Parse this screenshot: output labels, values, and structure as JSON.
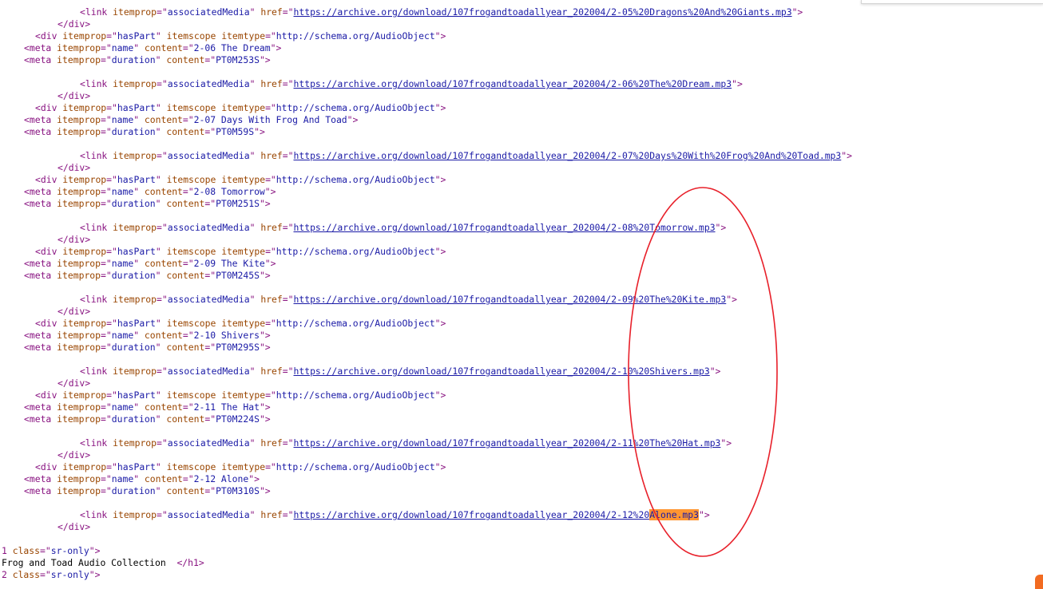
{
  "lines": [
    {
      "indent": 14,
      "segments": [
        [
          "tag",
          "<link "
        ],
        [
          "attr",
          "itemprop"
        ],
        [
          "tag",
          "=\""
        ],
        [
          "val",
          "associatedMedia"
        ],
        [
          "tag",
          "\" "
        ],
        [
          "attr",
          "href"
        ],
        [
          "tag",
          "=\""
        ],
        [
          "link",
          "https://archive.org/download/107frogandtoadallyear_202004/2-05%20Dragons%20And%20Giants.mp3"
        ],
        [
          "tag",
          "\">"
        ]
      ]
    },
    {
      "indent": 10,
      "segments": [
        [
          "tag",
          "</div>"
        ]
      ]
    },
    {
      "indent": 6,
      "segments": [
        [
          "tag",
          "<div "
        ],
        [
          "attr",
          "itemprop"
        ],
        [
          "tag",
          "=\""
        ],
        [
          "val",
          "hasPart"
        ],
        [
          "tag",
          "\" "
        ],
        [
          "attr",
          "itemscope itemtype"
        ],
        [
          "tag",
          "=\""
        ],
        [
          "val",
          "http://schema.org/AudioObject"
        ],
        [
          "tag",
          "\">"
        ]
      ]
    },
    {
      "indent": 4,
      "segments": [
        [
          "tag",
          "<meta "
        ],
        [
          "attr",
          "itemprop"
        ],
        [
          "tag",
          "=\""
        ],
        [
          "val",
          "name"
        ],
        [
          "tag",
          "\" "
        ],
        [
          "attr",
          "content"
        ],
        [
          "tag",
          "=\""
        ],
        [
          "val",
          "2-06 The Dream"
        ],
        [
          "tag",
          "\">"
        ]
      ]
    },
    {
      "indent": 4,
      "segments": [
        [
          "tag",
          "<meta "
        ],
        [
          "attr",
          "itemprop"
        ],
        [
          "tag",
          "=\""
        ],
        [
          "val",
          "duration"
        ],
        [
          "tag",
          "\" "
        ],
        [
          "attr",
          "content"
        ],
        [
          "tag",
          "=\""
        ],
        [
          "val",
          "PT0M253S"
        ],
        [
          "tag",
          "\">"
        ]
      ]
    },
    {
      "indent": 0,
      "segments": []
    },
    {
      "indent": 14,
      "segments": [
        [
          "tag",
          "<link "
        ],
        [
          "attr",
          "itemprop"
        ],
        [
          "tag",
          "=\""
        ],
        [
          "val",
          "associatedMedia"
        ],
        [
          "tag",
          "\" "
        ],
        [
          "attr",
          "href"
        ],
        [
          "tag",
          "=\""
        ],
        [
          "link",
          "https://archive.org/download/107frogandtoadallyear_202004/2-06%20The%20Dream.mp3"
        ],
        [
          "tag",
          "\">"
        ]
      ]
    },
    {
      "indent": 10,
      "segments": [
        [
          "tag",
          "</div>"
        ]
      ]
    },
    {
      "indent": 6,
      "segments": [
        [
          "tag",
          "<div "
        ],
        [
          "attr",
          "itemprop"
        ],
        [
          "tag",
          "=\""
        ],
        [
          "val",
          "hasPart"
        ],
        [
          "tag",
          "\" "
        ],
        [
          "attr",
          "itemscope itemtype"
        ],
        [
          "tag",
          "=\""
        ],
        [
          "val",
          "http://schema.org/AudioObject"
        ],
        [
          "tag",
          "\">"
        ]
      ]
    },
    {
      "indent": 4,
      "segments": [
        [
          "tag",
          "<meta "
        ],
        [
          "attr",
          "itemprop"
        ],
        [
          "tag",
          "=\""
        ],
        [
          "val",
          "name"
        ],
        [
          "tag",
          "\" "
        ],
        [
          "attr",
          "content"
        ],
        [
          "tag",
          "=\""
        ],
        [
          "val",
          "2-07 Days With Frog And Toad"
        ],
        [
          "tag",
          "\">"
        ]
      ]
    },
    {
      "indent": 4,
      "segments": [
        [
          "tag",
          "<meta "
        ],
        [
          "attr",
          "itemprop"
        ],
        [
          "tag",
          "=\""
        ],
        [
          "val",
          "duration"
        ],
        [
          "tag",
          "\" "
        ],
        [
          "attr",
          "content"
        ],
        [
          "tag",
          "=\""
        ],
        [
          "val",
          "PT0M59S"
        ],
        [
          "tag",
          "\">"
        ]
      ]
    },
    {
      "indent": 0,
      "segments": []
    },
    {
      "indent": 14,
      "segments": [
        [
          "tag",
          "<link "
        ],
        [
          "attr",
          "itemprop"
        ],
        [
          "tag",
          "=\""
        ],
        [
          "val",
          "associatedMedia"
        ],
        [
          "tag",
          "\" "
        ],
        [
          "attr",
          "href"
        ],
        [
          "tag",
          "=\""
        ],
        [
          "link",
          "https://archive.org/download/107frogandtoadallyear_202004/2-07%20Days%20With%20Frog%20And%20Toad.mp3"
        ],
        [
          "tag",
          "\">"
        ]
      ]
    },
    {
      "indent": 10,
      "segments": [
        [
          "tag",
          "</div>"
        ]
      ]
    },
    {
      "indent": 6,
      "segments": [
        [
          "tag",
          "<div "
        ],
        [
          "attr",
          "itemprop"
        ],
        [
          "tag",
          "=\""
        ],
        [
          "val",
          "hasPart"
        ],
        [
          "tag",
          "\" "
        ],
        [
          "attr",
          "itemscope itemtype"
        ],
        [
          "tag",
          "=\""
        ],
        [
          "val",
          "http://schema.org/AudioObject"
        ],
        [
          "tag",
          "\">"
        ]
      ]
    },
    {
      "indent": 4,
      "segments": [
        [
          "tag",
          "<meta "
        ],
        [
          "attr",
          "itemprop"
        ],
        [
          "tag",
          "=\""
        ],
        [
          "val",
          "name"
        ],
        [
          "tag",
          "\" "
        ],
        [
          "attr",
          "content"
        ],
        [
          "tag",
          "=\""
        ],
        [
          "val",
          "2-08 Tomorrow"
        ],
        [
          "tag",
          "\">"
        ]
      ]
    },
    {
      "indent": 4,
      "segments": [
        [
          "tag",
          "<meta "
        ],
        [
          "attr",
          "itemprop"
        ],
        [
          "tag",
          "=\""
        ],
        [
          "val",
          "duration"
        ],
        [
          "tag",
          "\" "
        ],
        [
          "attr",
          "content"
        ],
        [
          "tag",
          "=\""
        ],
        [
          "val",
          "PT0M251S"
        ],
        [
          "tag",
          "\">"
        ]
      ]
    },
    {
      "indent": 0,
      "segments": []
    },
    {
      "indent": 14,
      "segments": [
        [
          "tag",
          "<link "
        ],
        [
          "attr",
          "itemprop"
        ],
        [
          "tag",
          "=\""
        ],
        [
          "val",
          "associatedMedia"
        ],
        [
          "tag",
          "\" "
        ],
        [
          "attr",
          "href"
        ],
        [
          "tag",
          "=\""
        ],
        [
          "link",
          "https://archive.org/download/107frogandtoadallyear_202004/2-08%20Tomorrow.mp3"
        ],
        [
          "tag",
          "\">"
        ]
      ]
    },
    {
      "indent": 10,
      "segments": [
        [
          "tag",
          "</div>"
        ]
      ]
    },
    {
      "indent": 6,
      "segments": [
        [
          "tag",
          "<div "
        ],
        [
          "attr",
          "itemprop"
        ],
        [
          "tag",
          "=\""
        ],
        [
          "val",
          "hasPart"
        ],
        [
          "tag",
          "\" "
        ],
        [
          "attr",
          "itemscope itemtype"
        ],
        [
          "tag",
          "=\""
        ],
        [
          "val",
          "http://schema.org/AudioObject"
        ],
        [
          "tag",
          "\">"
        ]
      ]
    },
    {
      "indent": 4,
      "segments": [
        [
          "tag",
          "<meta "
        ],
        [
          "attr",
          "itemprop"
        ],
        [
          "tag",
          "=\""
        ],
        [
          "val",
          "name"
        ],
        [
          "tag",
          "\" "
        ],
        [
          "attr",
          "content"
        ],
        [
          "tag",
          "=\""
        ],
        [
          "val",
          "2-09 The Kite"
        ],
        [
          "tag",
          "\">"
        ]
      ]
    },
    {
      "indent": 4,
      "segments": [
        [
          "tag",
          "<meta "
        ],
        [
          "attr",
          "itemprop"
        ],
        [
          "tag",
          "=\""
        ],
        [
          "val",
          "duration"
        ],
        [
          "tag",
          "\" "
        ],
        [
          "attr",
          "content"
        ],
        [
          "tag",
          "=\""
        ],
        [
          "val",
          "PT0M245S"
        ],
        [
          "tag",
          "\">"
        ]
      ]
    },
    {
      "indent": 0,
      "segments": []
    },
    {
      "indent": 14,
      "segments": [
        [
          "tag",
          "<link "
        ],
        [
          "attr",
          "itemprop"
        ],
        [
          "tag",
          "=\""
        ],
        [
          "val",
          "associatedMedia"
        ],
        [
          "tag",
          "\" "
        ],
        [
          "attr",
          "href"
        ],
        [
          "tag",
          "=\""
        ],
        [
          "link",
          "https://archive.org/download/107frogandtoadallyear_202004/2-09%20The%20Kite.mp3"
        ],
        [
          "tag",
          "\">"
        ]
      ]
    },
    {
      "indent": 10,
      "segments": [
        [
          "tag",
          "</div>"
        ]
      ]
    },
    {
      "indent": 6,
      "segments": [
        [
          "tag",
          "<div "
        ],
        [
          "attr",
          "itemprop"
        ],
        [
          "tag",
          "=\""
        ],
        [
          "val",
          "hasPart"
        ],
        [
          "tag",
          "\" "
        ],
        [
          "attr",
          "itemscope itemtype"
        ],
        [
          "tag",
          "=\""
        ],
        [
          "val",
          "http://schema.org/AudioObject"
        ],
        [
          "tag",
          "\">"
        ]
      ]
    },
    {
      "indent": 4,
      "segments": [
        [
          "tag",
          "<meta "
        ],
        [
          "attr",
          "itemprop"
        ],
        [
          "tag",
          "=\""
        ],
        [
          "val",
          "name"
        ],
        [
          "tag",
          "\" "
        ],
        [
          "attr",
          "content"
        ],
        [
          "tag",
          "=\""
        ],
        [
          "val",
          "2-10 Shivers"
        ],
        [
          "tag",
          "\">"
        ]
      ]
    },
    {
      "indent": 4,
      "segments": [
        [
          "tag",
          "<meta "
        ],
        [
          "attr",
          "itemprop"
        ],
        [
          "tag",
          "=\""
        ],
        [
          "val",
          "duration"
        ],
        [
          "tag",
          "\" "
        ],
        [
          "attr",
          "content"
        ],
        [
          "tag",
          "=\""
        ],
        [
          "val",
          "PT0M295S"
        ],
        [
          "tag",
          "\">"
        ]
      ]
    },
    {
      "indent": 0,
      "segments": []
    },
    {
      "indent": 14,
      "segments": [
        [
          "tag",
          "<link "
        ],
        [
          "attr",
          "itemprop"
        ],
        [
          "tag",
          "=\""
        ],
        [
          "val",
          "associatedMedia"
        ],
        [
          "tag",
          "\" "
        ],
        [
          "attr",
          "href"
        ],
        [
          "tag",
          "=\""
        ],
        [
          "link",
          "https://archive.org/download/107frogandtoadallyear_202004/2-10%20Shivers.mp3"
        ],
        [
          "tag",
          "\">"
        ]
      ]
    },
    {
      "indent": 10,
      "segments": [
        [
          "tag",
          "</div>"
        ]
      ]
    },
    {
      "indent": 6,
      "segments": [
        [
          "tag",
          "<div "
        ],
        [
          "attr",
          "itemprop"
        ],
        [
          "tag",
          "=\""
        ],
        [
          "val",
          "hasPart"
        ],
        [
          "tag",
          "\" "
        ],
        [
          "attr",
          "itemscope itemtype"
        ],
        [
          "tag",
          "=\""
        ],
        [
          "val",
          "http://schema.org/AudioObject"
        ],
        [
          "tag",
          "\">"
        ]
      ]
    },
    {
      "indent": 4,
      "segments": [
        [
          "tag",
          "<meta "
        ],
        [
          "attr",
          "itemprop"
        ],
        [
          "tag",
          "=\""
        ],
        [
          "val",
          "name"
        ],
        [
          "tag",
          "\" "
        ],
        [
          "attr",
          "content"
        ],
        [
          "tag",
          "=\""
        ],
        [
          "val",
          "2-11 The Hat"
        ],
        [
          "tag",
          "\">"
        ]
      ]
    },
    {
      "indent": 4,
      "segments": [
        [
          "tag",
          "<meta "
        ],
        [
          "attr",
          "itemprop"
        ],
        [
          "tag",
          "=\""
        ],
        [
          "val",
          "duration"
        ],
        [
          "tag",
          "\" "
        ],
        [
          "attr",
          "content"
        ],
        [
          "tag",
          "=\""
        ],
        [
          "val",
          "PT0M224S"
        ],
        [
          "tag",
          "\">"
        ]
      ]
    },
    {
      "indent": 0,
      "segments": []
    },
    {
      "indent": 14,
      "segments": [
        [
          "tag",
          "<link "
        ],
        [
          "attr",
          "itemprop"
        ],
        [
          "tag",
          "=\""
        ],
        [
          "val",
          "associatedMedia"
        ],
        [
          "tag",
          "\" "
        ],
        [
          "attr",
          "href"
        ],
        [
          "tag",
          "=\""
        ],
        [
          "link",
          "https://archive.org/download/107frogandtoadallyear_202004/2-11%20The%20Hat.mp3"
        ],
        [
          "tag",
          "\">"
        ]
      ]
    },
    {
      "indent": 10,
      "segments": [
        [
          "tag",
          "</div>"
        ]
      ]
    },
    {
      "indent": 6,
      "segments": [
        [
          "tag",
          "<div "
        ],
        [
          "attr",
          "itemprop"
        ],
        [
          "tag",
          "=\""
        ],
        [
          "val",
          "hasPart"
        ],
        [
          "tag",
          "\" "
        ],
        [
          "attr",
          "itemscope itemtype"
        ],
        [
          "tag",
          "=\""
        ],
        [
          "val",
          "http://schema.org/AudioObject"
        ],
        [
          "tag",
          "\">"
        ]
      ]
    },
    {
      "indent": 4,
      "segments": [
        [
          "tag",
          "<meta "
        ],
        [
          "attr",
          "itemprop"
        ],
        [
          "tag",
          "=\""
        ],
        [
          "val",
          "name"
        ],
        [
          "tag",
          "\" "
        ],
        [
          "attr",
          "content"
        ],
        [
          "tag",
          "=\""
        ],
        [
          "val",
          "2-12 Alone"
        ],
        [
          "tag",
          "\">"
        ]
      ]
    },
    {
      "indent": 4,
      "segments": [
        [
          "tag",
          "<meta "
        ],
        [
          "attr",
          "itemprop"
        ],
        [
          "tag",
          "=\""
        ],
        [
          "val",
          "duration"
        ],
        [
          "tag",
          "\" "
        ],
        [
          "attr",
          "content"
        ],
        [
          "tag",
          "=\""
        ],
        [
          "val",
          "PT0M310S"
        ],
        [
          "tag",
          "\">"
        ]
      ]
    },
    {
      "indent": 0,
      "segments": []
    },
    {
      "indent": 14,
      "segments": [
        [
          "tag",
          "<link "
        ],
        [
          "attr",
          "itemprop"
        ],
        [
          "tag",
          "=\""
        ],
        [
          "val",
          "associatedMedia"
        ],
        [
          "tag",
          "\" "
        ],
        [
          "attr",
          "href"
        ],
        [
          "tag",
          "=\""
        ],
        [
          "link",
          "https://archive.org/download/107frogandtoadallyear_202004/2-12%20"
        ],
        [
          "highlight",
          "Alone.mp3"
        ],
        [
          "tag",
          "\">"
        ]
      ]
    },
    {
      "indent": 10,
      "segments": [
        [
          "tag",
          "</div>"
        ]
      ]
    },
    {
      "indent": 0,
      "segments": []
    },
    {
      "indent": 0,
      "segments": [
        [
          "tag",
          "1 "
        ],
        [
          "attr",
          "class"
        ],
        [
          "tag",
          "=\""
        ],
        [
          "val",
          "sr-only"
        ],
        [
          "tag",
          "\">"
        ]
      ]
    },
    {
      "indent": 0,
      "segments": [
        [
          "text",
          "Frog and Toad Audio Collection  "
        ],
        [
          "tag",
          "</h1>"
        ]
      ]
    },
    {
      "indent": 0,
      "segments": [
        [
          "tag",
          "2 "
        ],
        [
          "attr",
          "class"
        ],
        [
          "tag",
          "=\""
        ],
        [
          "val",
          "sr-only"
        ],
        [
          "tag",
          "\">"
        ]
      ]
    }
  ],
  "find_match": "Alone.mp3",
  "colors": {
    "tag": "#881280",
    "attribute": "#994500",
    "value": "#1a1aa6",
    "highlight": "#ff9632",
    "annotation": "#e8202a"
  }
}
